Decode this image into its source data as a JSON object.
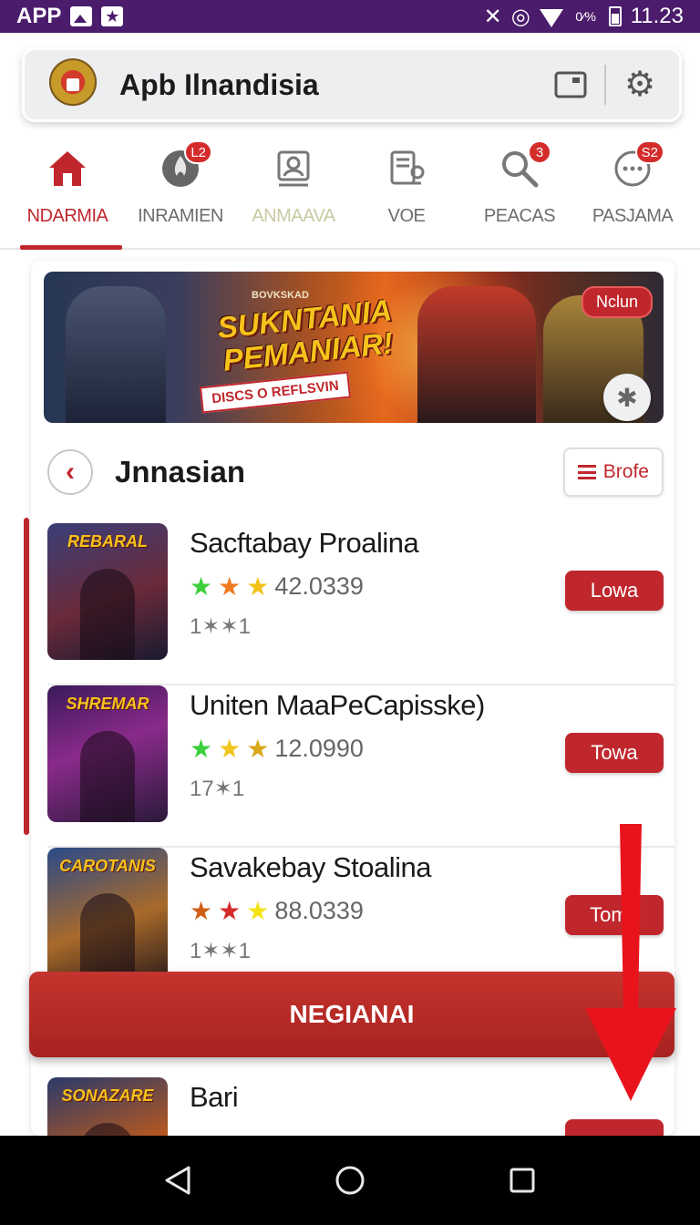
{
  "status_bar": {
    "left_label": "APP",
    "icons": [
      "image-icon",
      "star-icon"
    ],
    "right_icons": [
      "nfc-icon",
      "alarm-icon",
      "wifi-icon",
      "data-icon",
      "battery-icon"
    ],
    "data_label": "0⁄%",
    "time": "11.23"
  },
  "app_bar": {
    "title": "Apb Ilnandisia",
    "logo": "crest-logo",
    "actions": [
      "window-icon",
      "gear-icon"
    ]
  },
  "tabs": [
    {
      "label": "NDARMIA",
      "icon": "home-icon",
      "badge": "",
      "active": true
    },
    {
      "label": "INRAMIEN",
      "icon": "fire-icon",
      "badge": "L2",
      "active": false
    },
    {
      "label": "ANMAAVA",
      "icon": "person-board-icon",
      "badge": "",
      "active": false
    },
    {
      "label": "VOE",
      "icon": "controls-icon",
      "badge": "",
      "active": false
    },
    {
      "label": "PEACAS",
      "icon": "search-icon",
      "badge": "3",
      "active": false
    },
    {
      "label": "PASJAMA",
      "icon": "chat-icon",
      "badge": "S2",
      "active": false
    }
  ],
  "banner": {
    "kicker": "BOVKSKAD",
    "headline_line1": "SUKNTANIA",
    "headline_line2": "PEMANIAR!",
    "strip": "DISCS O REFLSVIN",
    "badge": "Nclun",
    "fab_icon": "asterisk-icon"
  },
  "section": {
    "title": "Jnnasian",
    "back_icon": "chevron-left-icon",
    "browse_label": "Brofe"
  },
  "games": [
    {
      "thumb_title": "REBARAL",
      "name": "Sacftabay Proalina",
      "stars": [
        "#3ccf3c",
        "#f07a1e",
        "#f2c318"
      ],
      "rating": "42.0339",
      "meta": "1✶✶1",
      "button": "Lowa"
    },
    {
      "thumb_title": "SHREMAR",
      "name": "Uniten MaaPeCapisske)",
      "stars": [
        "#3ccf3c",
        "#f2c318",
        "#d8a81a"
      ],
      "rating": "12.0990",
      "meta": "17✶1",
      "button": "Towa"
    },
    {
      "thumb_title": "CAROTANIS",
      "name": "Savakebay Stoalina",
      "stars": [
        "#d06018",
        "#d42b2b",
        "#f2e318"
      ],
      "rating": "88.0339",
      "meta": "1✶✶1",
      "button": "Tome"
    },
    {
      "thumb_title": "SONAZARE",
      "name": "Bari",
      "stars": [],
      "rating": "",
      "meta": "",
      "button": ""
    }
  ],
  "cta": {
    "label": "NEGIANAI"
  },
  "nav": [
    "back-icon",
    "home-circle-icon",
    "recents-icon"
  ],
  "colors": {
    "accent": "#c0272d",
    "status_bar": "#4a1c6b",
    "annotation": "#e8131b"
  }
}
